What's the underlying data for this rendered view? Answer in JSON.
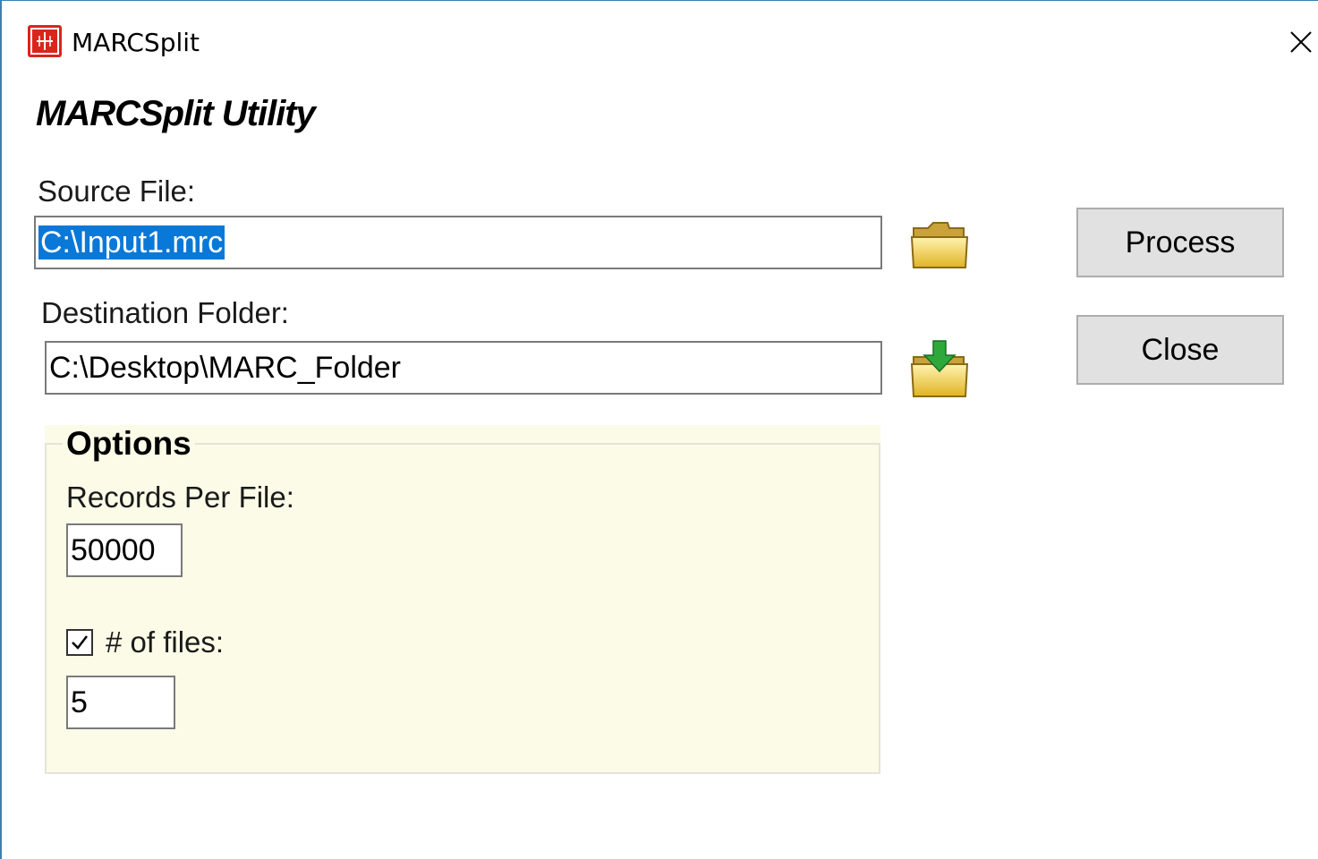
{
  "window": {
    "title": "MARCSplit",
    "close_glyph": "✕"
  },
  "heading": "MARCSplit Utility",
  "source": {
    "label": "Source File:",
    "value": "C:\\Input1.mrc",
    "browse_icon": "open-folder-icon"
  },
  "destination": {
    "label": "Destination Folder:",
    "value": "C:\\Desktop\\MARC_Folder",
    "browse_icon": "download-folder-icon"
  },
  "buttons": {
    "process": "Process",
    "close": "Close"
  },
  "options": {
    "legend": "Options",
    "records_label": "Records Per File:",
    "records_value": "50000",
    "num_files_label": "# of files:",
    "num_files_checked": true,
    "num_files_value": "5"
  },
  "colors": {
    "options_bg": "#fbfbe8",
    "selection": "#0a78d7",
    "app_icon": "#d8261c"
  }
}
